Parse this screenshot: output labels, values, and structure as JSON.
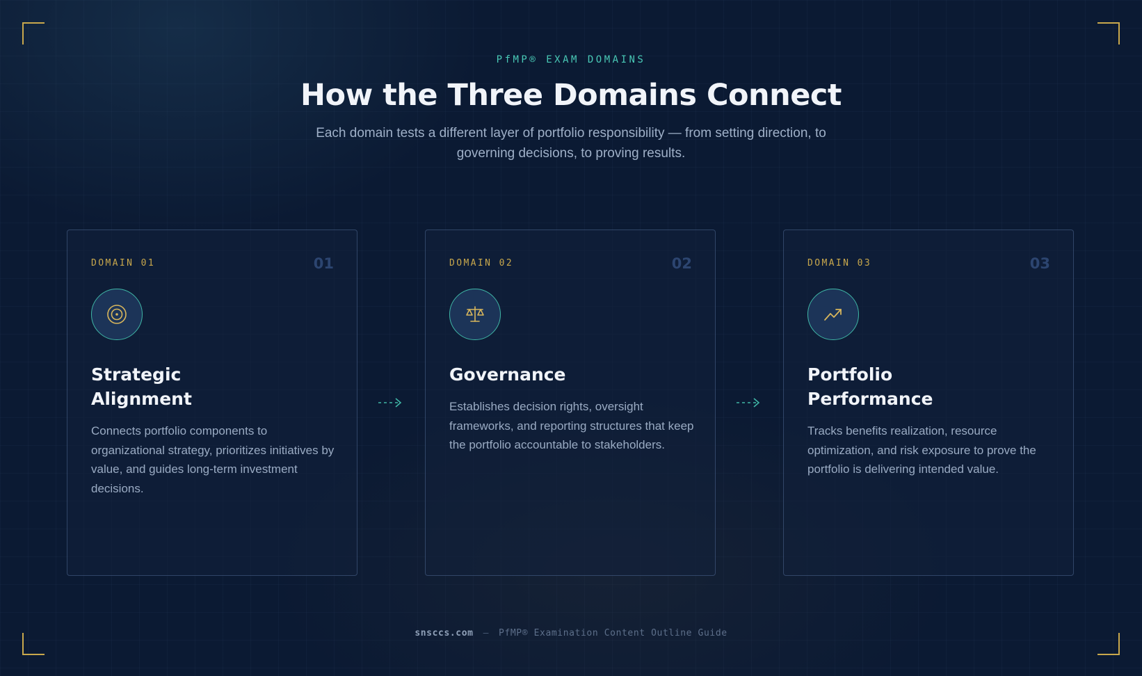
{
  "colors": {
    "background": "#0b1a33",
    "accent_teal": "#49c9b6",
    "accent_gold": "#c9a84c",
    "card_border": "#34507a",
    "muted_number": "#2c4570"
  },
  "header": {
    "eyebrow": "PfMP® EXAM DOMAINS",
    "title": "How the Three Domains Connect",
    "subtitle": "Each domain tests a different layer of portfolio responsibility — from setting direction, to governing decisions, to proving results."
  },
  "domains": [
    {
      "label": "DOMAIN 01",
      "number": "01",
      "icon": "target-icon",
      "title_line1": "Strategic",
      "title_line2": "Alignment",
      "description": "Connects portfolio components to organizational strategy, prioritizes initiatives by value, and guides long-term investment decisions."
    },
    {
      "label": "DOMAIN 02",
      "number": "02",
      "icon": "scale-icon",
      "title_line1": "Governance",
      "title_line2": "",
      "description": "Establishes decision rights, oversight frameworks, and reporting structures that keep the portfolio accountable to stakeholders."
    },
    {
      "label": "DOMAIN 03",
      "number": "03",
      "icon": "trending-up-icon",
      "title_line1": "Portfolio",
      "title_line2": "Performance",
      "description": "Tracks benefits realization, resource optimization, and risk exposure to prove the portfolio is delivering intended value."
    }
  ],
  "connectors": [
    {
      "icon": "dashed-arrow-icon"
    },
    {
      "icon": "dashed-arrow-icon"
    }
  ],
  "footer": {
    "site": "snsccs.com",
    "separator": "—",
    "guide": "PfMP® Examination Content Outline Guide"
  }
}
